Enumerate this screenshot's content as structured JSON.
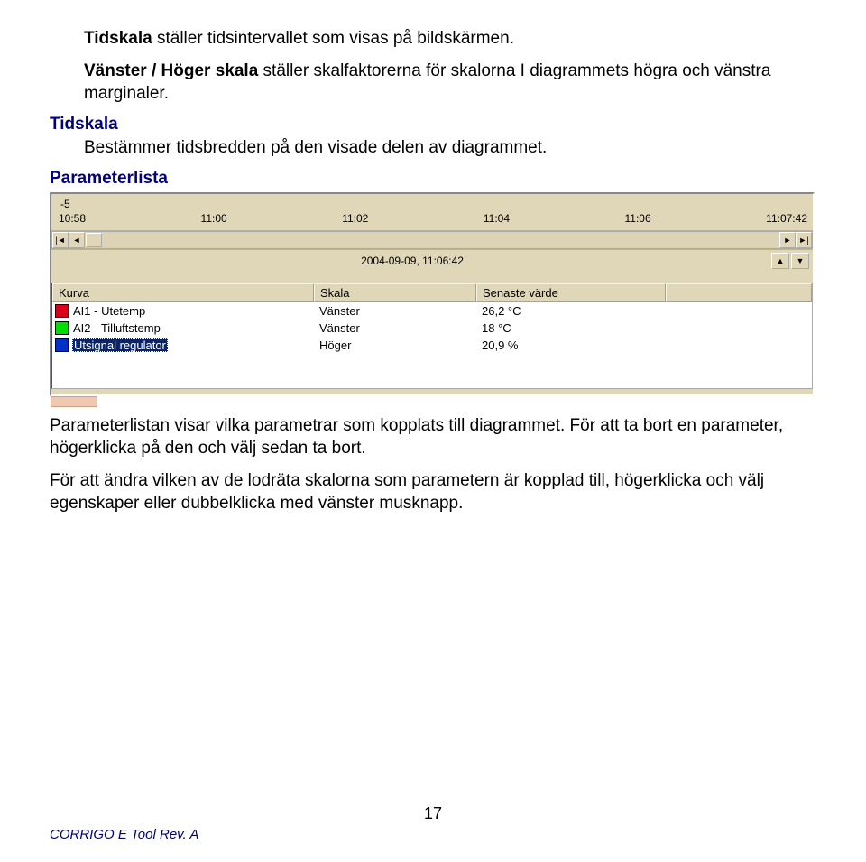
{
  "intro": {
    "line1a": "Tidskala",
    "line1b": " ställer tidsintervallet som visas på bildskärmen.",
    "line2a": "Vänster / Höger skala",
    "line2b": " ställer skalfaktorerna för skalorna I diagrammets högra och vänstra marginaler."
  },
  "sections": {
    "tidskala_heading": "Tidskala",
    "tidskala_body": "Bestämmer tidsbredden på den visade delen av diagrammet.",
    "paramlist_heading": "Parameterlista"
  },
  "axis": {
    "neg5": "-5",
    "ticks": [
      "10:58",
      "11:00",
      "11:02",
      "11:04",
      "11:06",
      "11:07:42"
    ]
  },
  "timestamp": "2004-09-09, 11:06:42",
  "table": {
    "headers": {
      "kurva": "Kurva",
      "skala": "Skala",
      "varde": "Senaste värde"
    },
    "rows": [
      {
        "color": "#d8001a",
        "label": "AI1 - Utetemp",
        "skala": "Vänster",
        "varde": "26,2 °C",
        "selected": false
      },
      {
        "color": "#00e000",
        "label": "AI2 - Tilluftstemp",
        "skala": "Vänster",
        "varde": "18 °C",
        "selected": false
      },
      {
        "color": "#0030c8",
        "label": "Utsignal regulator",
        "skala": "Höger",
        "varde": "20,9 %",
        "selected": true
      }
    ]
  },
  "after": {
    "p1": "Parameterlistan visar vilka parametrar som kopplats till diagrammet. För att ta bort en parameter, högerklicka på den och välj sedan ta bort.",
    "p2": "För att ändra vilken av de lodräta skalorna som parametern är kopplad till, högerklicka och välj egenskaper eller dubbelklicka med vänster musknapp."
  },
  "footer": {
    "product_a": "CORRIGO",
    "product_b": " E Tool  Rev. A",
    "page": "17"
  },
  "glyphs": {
    "left": "◄",
    "right": "►",
    "bar": "|",
    "up": "▲",
    "down": "▼"
  }
}
